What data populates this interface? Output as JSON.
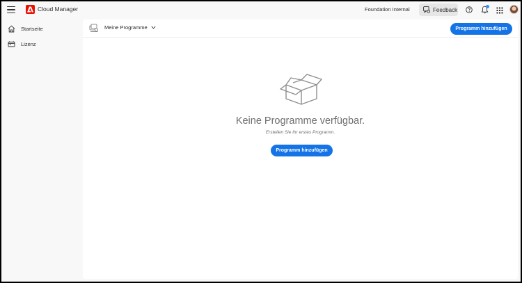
{
  "app": {
    "title": "Cloud Manager",
    "org_name": "Foundation Internal",
    "feedback_label": "Feedback",
    "brand_color": "#eb1000",
    "accent_color": "#1473e6",
    "notification_dot_color": "#378ef0"
  },
  "icons": {
    "menu": "hamburger-menu-icon",
    "logo": "adobe-logo-icon",
    "feedback": "feedback-icon",
    "help": "help-icon",
    "notifications": "bell-icon",
    "apps": "app-grid-icon",
    "avatar": "user-avatar"
  },
  "sidebar": {
    "items": [
      {
        "label": "Startseite",
        "icon": "home-icon"
      },
      {
        "label": "Lizenz",
        "icon": "license-icon"
      }
    ]
  },
  "main": {
    "program_selector_label": "Meine Programme",
    "add_program_label": "Programm hinzufügen",
    "empty_state": {
      "title": "Keine Programme verfügbar.",
      "subtitle": "Erstellen Sie Ihr erstes Programm.",
      "button_label": "Programm hinzufügen",
      "illustration": "empty-box-illustration"
    }
  }
}
